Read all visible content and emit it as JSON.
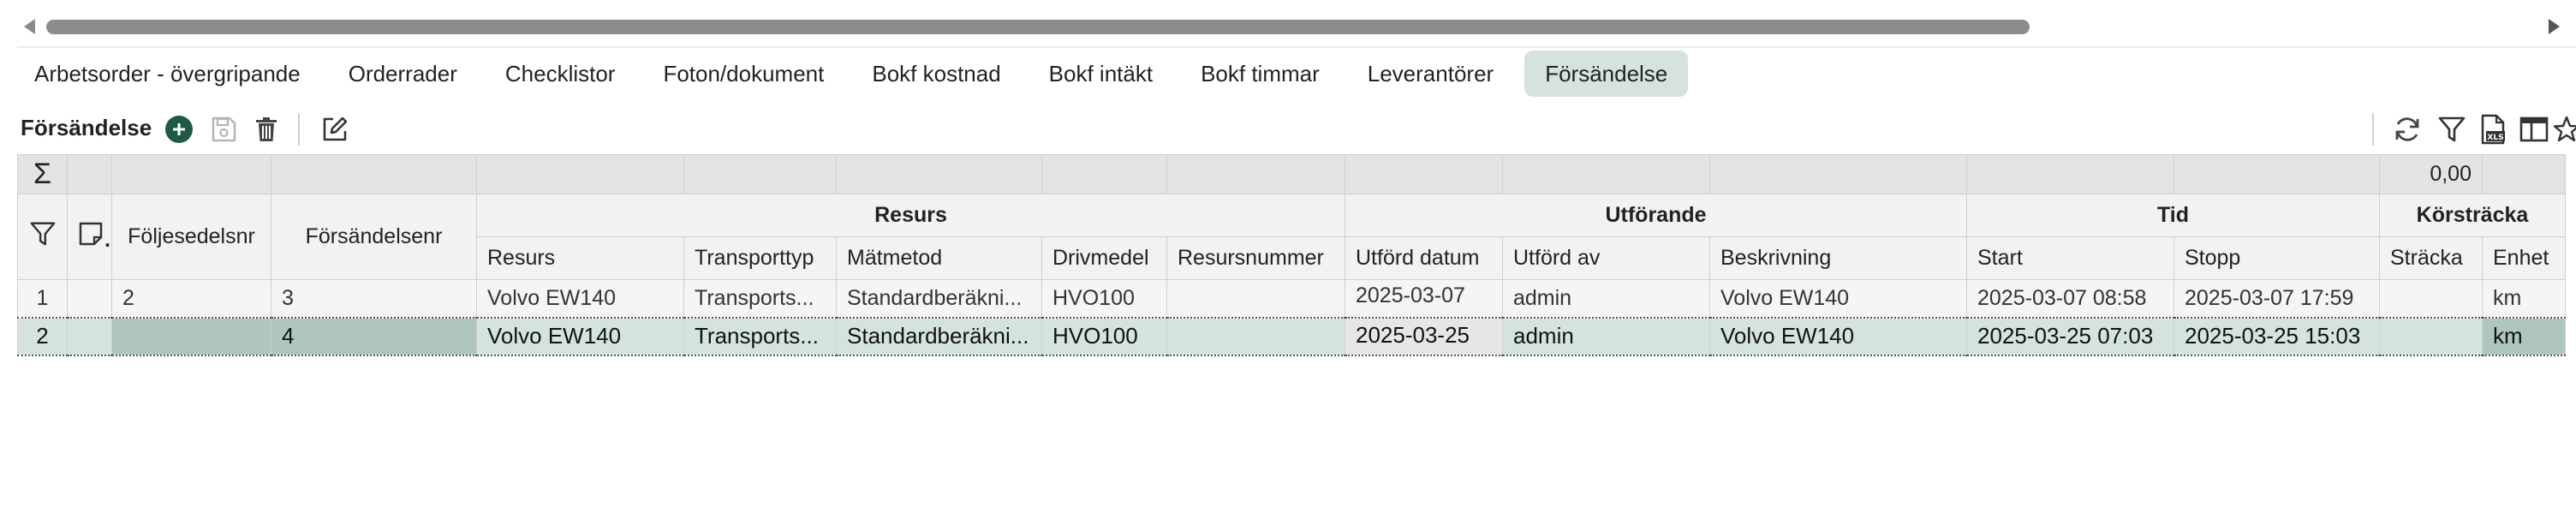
{
  "tabs": [
    {
      "label": "Arbetsorder - övergripande",
      "active": false
    },
    {
      "label": "Orderrader",
      "active": false
    },
    {
      "label": "Checklistor",
      "active": false
    },
    {
      "label": "Foton/dokument",
      "active": false
    },
    {
      "label": "Bokf kostnad",
      "active": false
    },
    {
      "label": "Bokf intäkt",
      "active": false
    },
    {
      "label": "Bokf timmar",
      "active": false
    },
    {
      "label": "Leverantörer",
      "active": false
    },
    {
      "label": "Försändelse",
      "active": true
    }
  ],
  "toolbar": {
    "title": "Försändelse",
    "left_icons": [
      "add-icon",
      "save-icon",
      "delete-icon",
      "edit-icon"
    ],
    "right_icons": [
      "refresh-icon",
      "filter-icon",
      "export-xls-icon",
      "columns-icon",
      "favorite-icon"
    ],
    "accent": "#1e5a46"
  },
  "grid": {
    "sum_symbol": "Σ",
    "sum_value": "0,00",
    "groups": {
      "resurs": "Resurs",
      "utforande": "Utförande",
      "tid": "Tid",
      "korstracka": "Körsträcka"
    },
    "columns": {
      "foljesedelsnr": "Följesedelsnr",
      "forsandelsenr": "Försändelsenr",
      "resurs": "Resurs",
      "transporttyp": "Transporttyp",
      "matmetod": "Mätmetod",
      "drivmedel": "Drivmedel",
      "resursnummer": "Resursnummer",
      "utford_datum": "Utförd datum",
      "utford_av": "Utförd av",
      "beskrivning": "Beskrivning",
      "start": "Start",
      "stopp": "Stopp",
      "stracka": "Sträcka",
      "enhet": "Enhet"
    },
    "rows": [
      {
        "rownum": "1",
        "foljesedelsnr": "2",
        "forsandelsenr": "3",
        "resurs": "Volvo EW140",
        "transporttyp": "Transports...",
        "matmetod": "Standardberäkni...",
        "drivmedel": "HVO100",
        "resursnummer": "",
        "utford_datum": "2025-03-07",
        "utford_av": "admin",
        "beskrivning": "Volvo EW140",
        "start": "2025-03-07 08:58",
        "stopp": "2025-03-07 17:59",
        "stracka": "",
        "enhet": "km"
      },
      {
        "rownum": "2",
        "foljesedelsnr": "",
        "forsandelsenr": "4",
        "resurs": "Volvo EW140",
        "transporttyp": "Transports...",
        "matmetod": "Standardberäkni...",
        "drivmedel": "HVO100",
        "resursnummer": "",
        "utford_datum": "2025-03-25",
        "utford_av": "admin",
        "beskrivning": "Volvo EW140",
        "start": "2025-03-25 07:03",
        "stopp": "2025-03-25 15:03",
        "stracka": "",
        "enhet": "km"
      }
    ]
  }
}
